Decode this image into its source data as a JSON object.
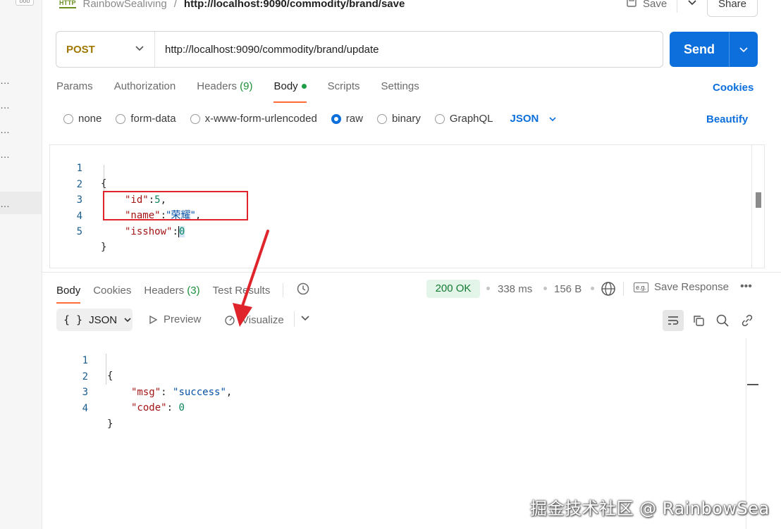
{
  "breadcrumb": {
    "http_badge": "HTTP",
    "collection": "RainbowSealiving",
    "separator": "/",
    "request_name": "http://localhost:9090/commodity/brand/save"
  },
  "header_actions": {
    "save_label": "Save",
    "share_label": "Share"
  },
  "request": {
    "method": "POST",
    "url": "http://localhost:9090/commodity/brand/update",
    "send_label": "Send"
  },
  "request_tabs": [
    {
      "label": "Params"
    },
    {
      "label": "Authorization"
    },
    {
      "label": "Headers",
      "count": "(9)"
    },
    {
      "label": "Body",
      "active": true
    },
    {
      "label": "Scripts"
    },
    {
      "label": "Settings"
    }
  ],
  "cookies_link": "Cookies",
  "body_types": [
    "none",
    "form-data",
    "x-www-form-urlencoded",
    "raw",
    "binary",
    "GraphQL"
  ],
  "body_type_selected": "raw",
  "body_format": "JSON",
  "beautify_label": "Beautify",
  "request_body": {
    "line_numbers": [
      "1",
      "2",
      "3",
      "4",
      "5"
    ],
    "open_brace": "{",
    "id_key": "\"id\"",
    "id_colon": ":",
    "id_value": "5",
    "id_comma": ",",
    "name_key": "\"name\"",
    "name_colon": ":",
    "name_value": "\"荣耀\"",
    "name_comma": ",",
    "isshow_key": "\"isshow\"",
    "isshow_colon": ":",
    "isshow_value": "0",
    "close_brace": "}"
  },
  "response_tabs": [
    {
      "label": "Body",
      "active": true
    },
    {
      "label": "Cookies"
    },
    {
      "label": "Headers",
      "count": "(3)"
    },
    {
      "label": "Test Results"
    }
  ],
  "response_meta": {
    "status": "200 OK",
    "time": "338 ms",
    "size": "156 B",
    "save_response": "Save Response"
  },
  "response_toolbar": {
    "format": "JSON",
    "braces": "{ }",
    "preview": "Preview",
    "visualize": "Visualize"
  },
  "response_body": {
    "line_numbers": [
      "1",
      "2",
      "3",
      "4"
    ],
    "open_brace": "{",
    "msg_key": "\"msg\"",
    "msg_colon": ": ",
    "msg_value": "\"success\"",
    "msg_comma": ",",
    "code_key": "\"code\"",
    "code_colon": ": ",
    "code_value": "0",
    "close_brace": "}"
  },
  "watermark": "掘金技术社区 @ RainbowSea",
  "colors": {
    "accent": "#0c6fdc",
    "tab_underline": "#ff6c37",
    "status_bg": "#e3f5e8",
    "annotation_red": "#e0242b"
  }
}
